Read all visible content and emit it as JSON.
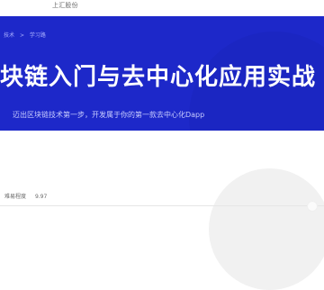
{
  "topbar": {
    "left_text": "",
    "right_text": "上汇股份"
  },
  "hero": {
    "breadcrumb": [
      "技术",
      "学习路"
    ],
    "title": "块链入门与去中心化应用实战",
    "subtitle": "迈出区块链技术第一步，开发属于你的第一款去中心化Dapp"
  },
  "meta": {
    "label": "难易程度",
    "value": "9.97"
  },
  "colors": {
    "hero_bg": "#1d28c9",
    "title": "#ffffff",
    "subtitle": "#c8ccff"
  }
}
